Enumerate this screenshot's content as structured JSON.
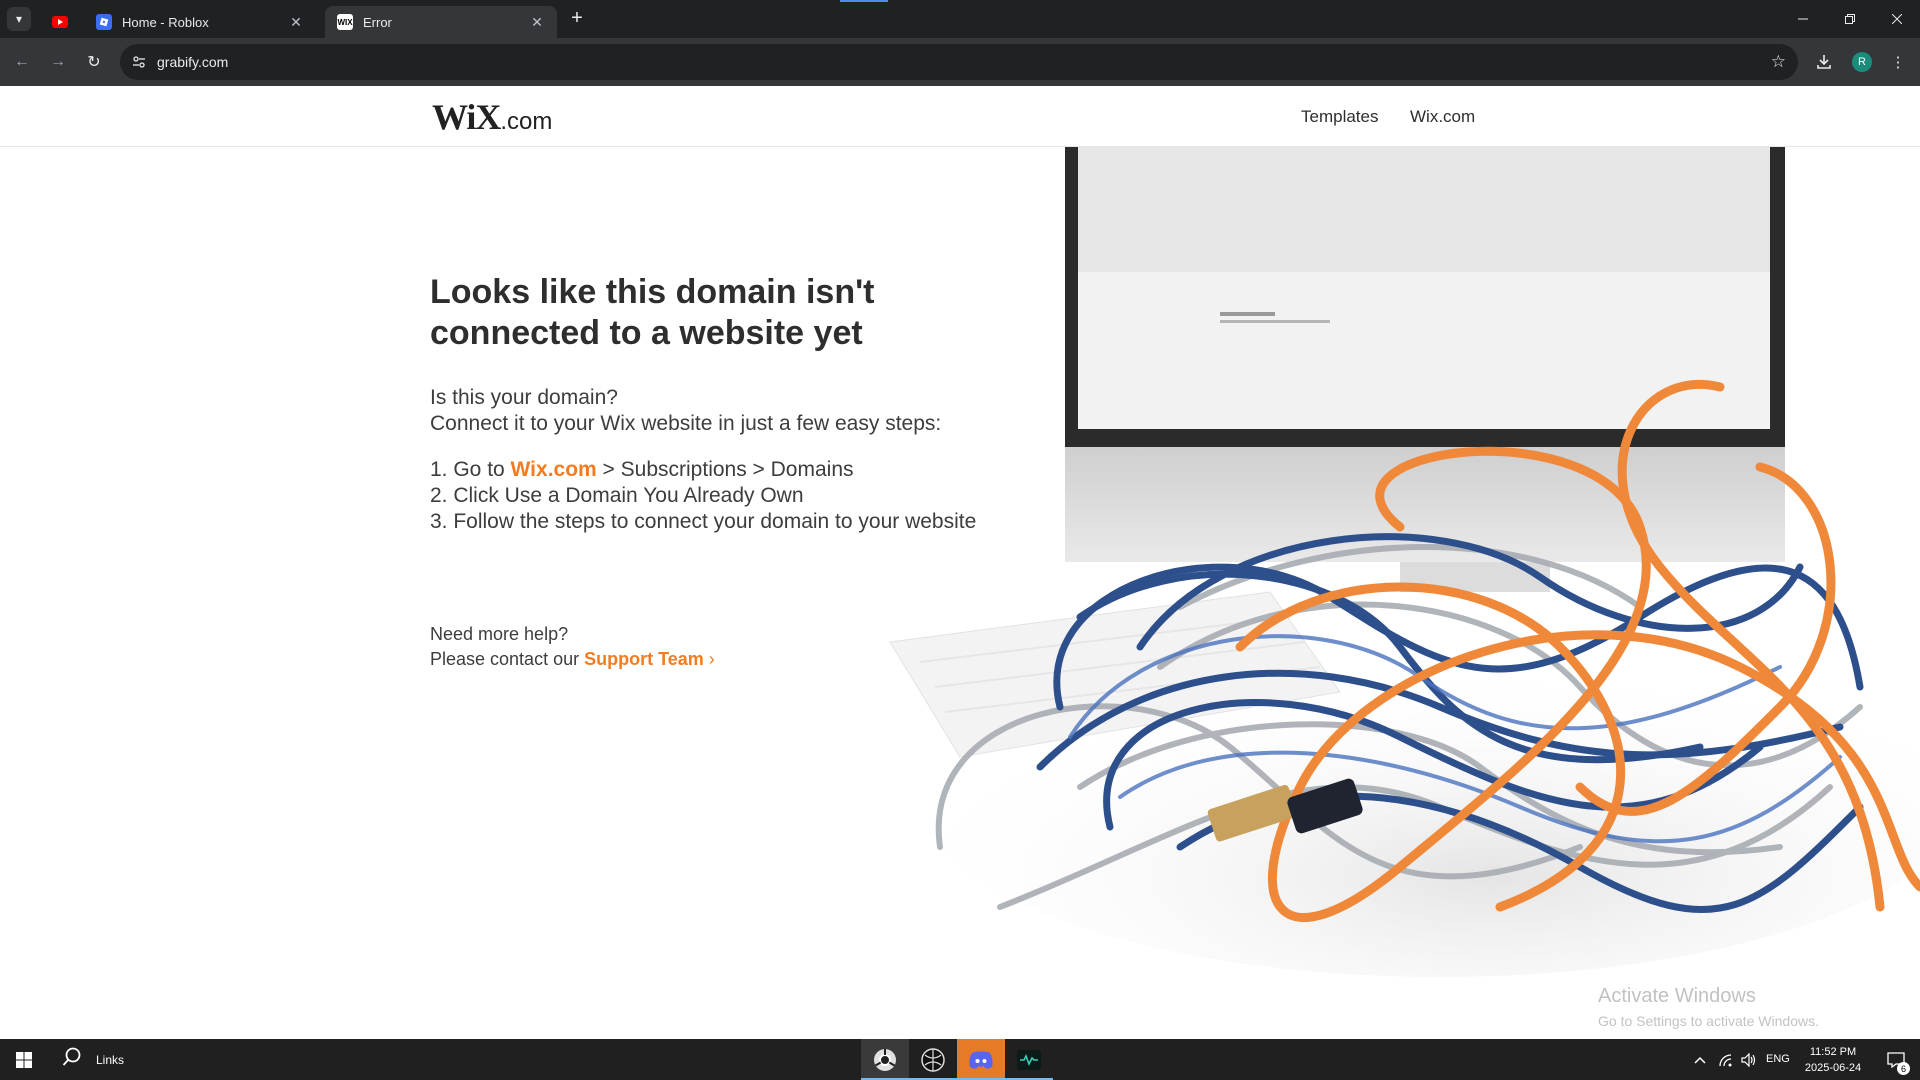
{
  "browser": {
    "tabs": [
      {
        "title": "",
        "icon": "youtube-icon"
      },
      {
        "title": "Home - Roblox",
        "icon": "roblox-icon"
      },
      {
        "title": "Error",
        "icon": "wix-icon",
        "active": true
      }
    ],
    "url": "grabify.com",
    "profile_initial": "R"
  },
  "header": {
    "logo_main": "WiX",
    "logo_suffix": ".com",
    "nav": [
      "Templates",
      "Wix.com"
    ]
  },
  "content": {
    "headline": "Looks like this domain isn't connected to a website yet",
    "intro_1": "Is this your domain?",
    "intro_2": "Connect it to your Wix website in just a few easy steps:",
    "step1_prefix": "1. Go to ",
    "step1_link": "Wix.com",
    "step1_suffix": " > Subscriptions > Domains",
    "step2": "2. Click Use a Domain You Already Own",
    "step3": "3. Follow the steps to connect your domain to your website",
    "help_1": "Need more help?",
    "help_2_prefix": "Please contact our ",
    "help_2_link": "Support Team",
    "help_2_arrow": "›"
  },
  "watermark": {
    "line1": "Activate Windows",
    "line2": "Go to Settings to activate Windows."
  },
  "taskbar": {
    "search_label": "Links",
    "language": "ENG",
    "time": "11:52 PM",
    "date": "2025-06-24",
    "notification_count": "6"
  },
  "colors": {
    "accent_orange": "#f47c20",
    "chrome_dark": "#202124",
    "chrome_toolbar": "#35363a"
  }
}
